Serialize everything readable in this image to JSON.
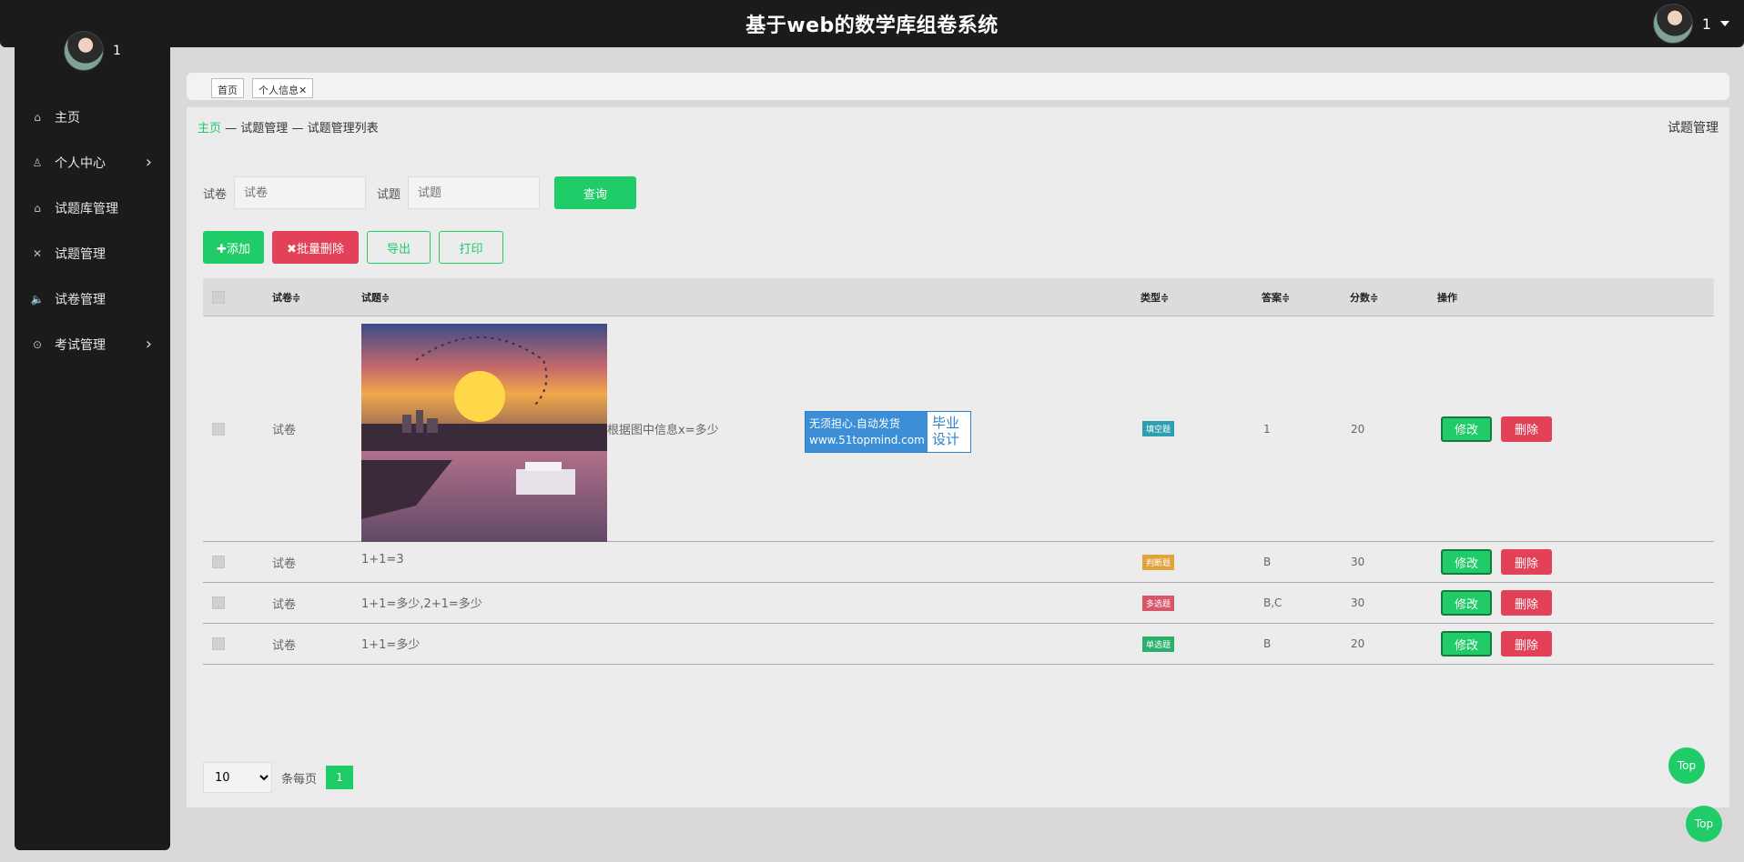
{
  "header": {
    "title": "基于web的数学库组卷系统",
    "user_name": "1"
  },
  "sidebar": {
    "profile_name": "1",
    "items": [
      {
        "label": "主页",
        "icon": "home-icon",
        "glyph": "⌂",
        "has_children": false
      },
      {
        "label": "个人中心",
        "icon": "user-icon",
        "glyph": "♙",
        "has_children": true
      },
      {
        "label": "试题库管理",
        "icon": "home-icon",
        "glyph": "⌂",
        "has_children": false
      },
      {
        "label": "试题管理",
        "icon": "close-icon",
        "glyph": "✕",
        "has_children": false
      },
      {
        "label": "试卷管理",
        "icon": "speaker-icon",
        "glyph": "🔈",
        "has_children": false
      },
      {
        "label": "考试管理",
        "icon": "download-circle-icon",
        "glyph": "⊙",
        "has_children": true
      }
    ]
  },
  "tabs": [
    {
      "label": "首页"
    },
    {
      "label": "个人信息",
      "close": "✕"
    }
  ],
  "breadcrumb": {
    "home": "主页",
    "sep1": "—",
    "level1": "试题管理",
    "sep2": "—",
    "level2": "试题管理列表"
  },
  "page_title_right": "试题管理",
  "search": {
    "paper_label": "试卷",
    "paper_placeholder": "试卷",
    "question_label": "试题",
    "question_placeholder": "试题",
    "button": "查询"
  },
  "actions": {
    "add": "✚添加",
    "batch_delete": "✖批量删除",
    "export": "导出",
    "print": "打印"
  },
  "table": {
    "columns": {
      "paper": "试卷≑",
      "question": "试题≑",
      "type": "类型≑",
      "answer": "答案≑",
      "score": "分数≑",
      "ops": "操作"
    },
    "rows": [
      {
        "paper": "试卷",
        "question": "根据图中信息x=多少",
        "type": "填空题",
        "type_color": "#2f9fb0",
        "answer": "1",
        "score": "20",
        "has_image": true
      },
      {
        "paper": "试卷",
        "question": "1+1=3",
        "type": "判断题",
        "type_color": "#e3a23a",
        "answer": "B",
        "score": "30",
        "has_image": false
      },
      {
        "paper": "试卷",
        "question": "1+1=多少,2+1=多少",
        "type": "多选题",
        "type_color": "#d8566a",
        "answer": "B,C",
        "score": "30",
        "has_image": false
      },
      {
        "paper": "试卷",
        "question": "1+1=多少",
        "type": "单选题",
        "type_color": "#2ab06a",
        "answer": "B",
        "score": "20",
        "has_image": false
      }
    ],
    "edit_label": "修改",
    "delete_label": "删除"
  },
  "watermark": {
    "line1": "无须担心.自动发货",
    "line2": "www.51topmind.com",
    "right1": "毕业",
    "right2": "设计"
  },
  "pagination": {
    "page_size": "10",
    "per_page_label": "条每页",
    "current_page": "1"
  },
  "top_button": "Top",
  "colors": {
    "accent": "#1fcc67",
    "danger": "#e24158",
    "dark": "#1b1b1b"
  }
}
